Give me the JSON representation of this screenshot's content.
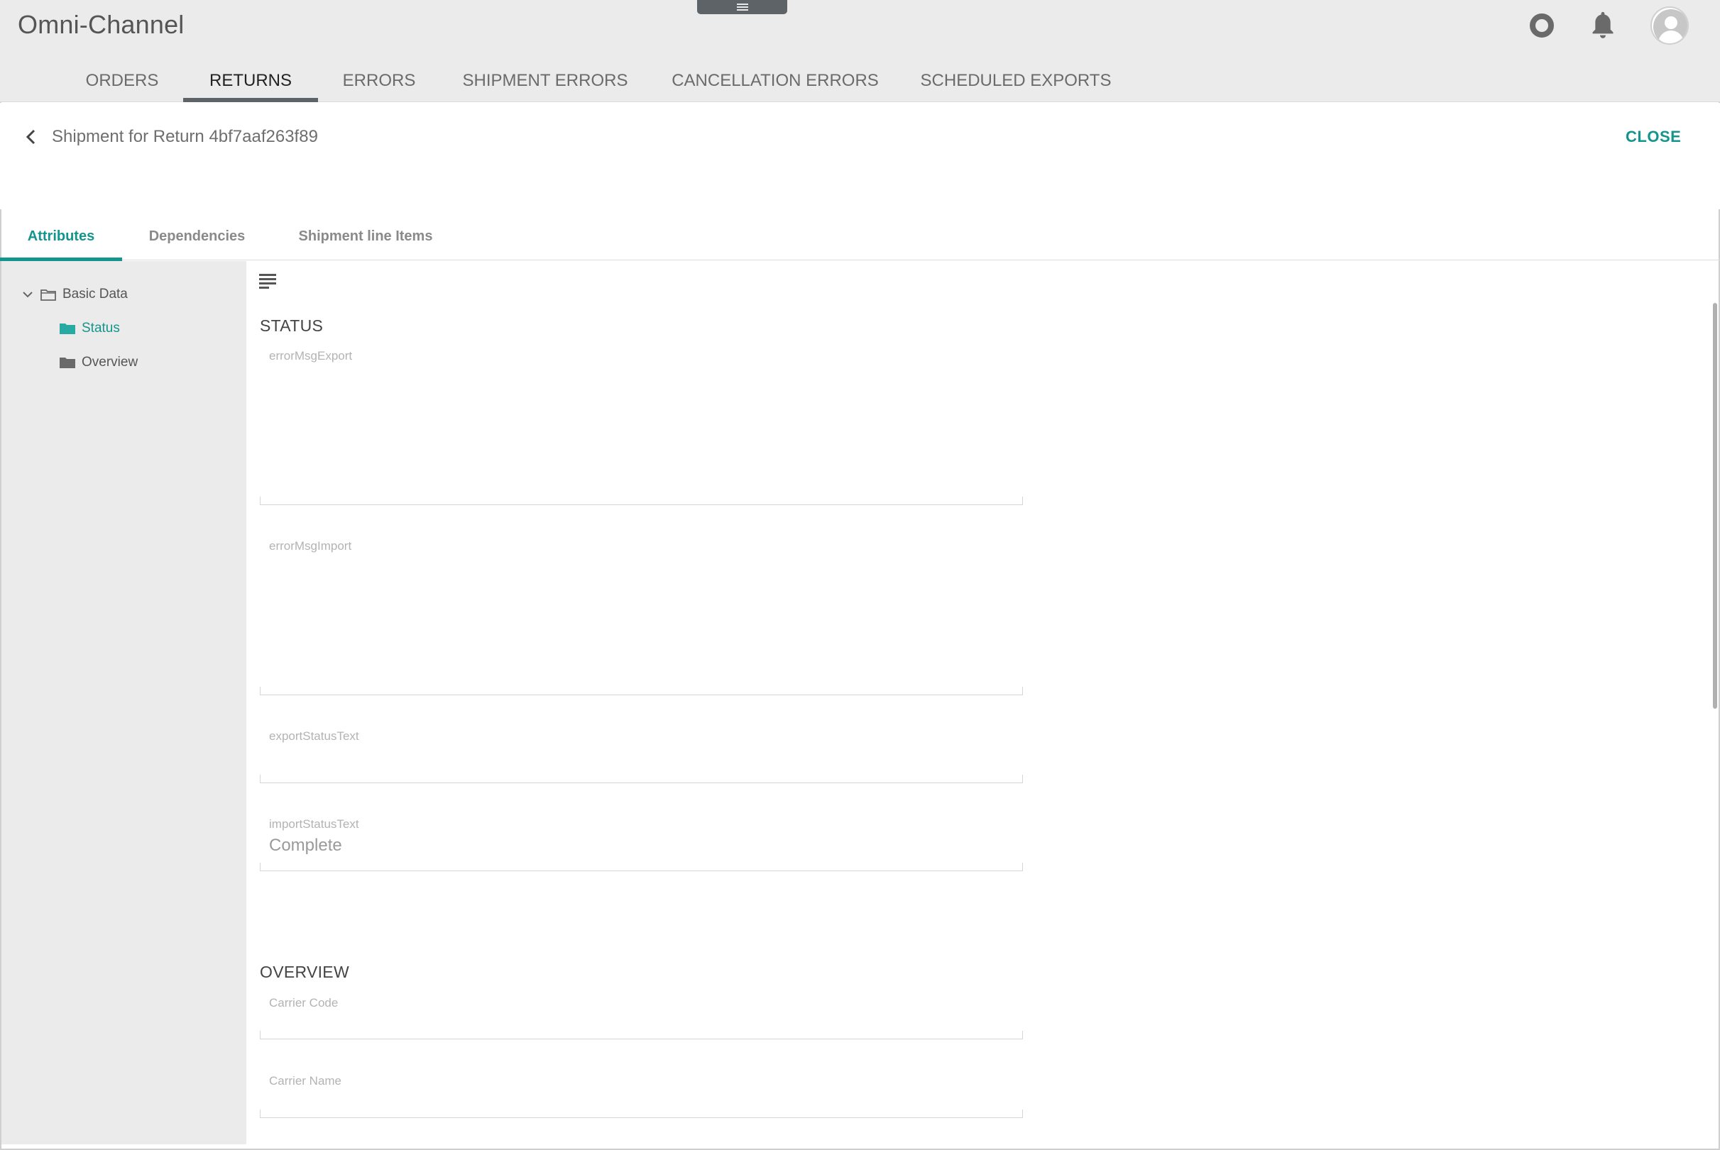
{
  "app": {
    "title": "Omni-Channel"
  },
  "nav": {
    "tabs": [
      {
        "label": "ORDERS",
        "active": false
      },
      {
        "label": "RETURNS",
        "active": true
      },
      {
        "label": "ERRORS",
        "active": false
      },
      {
        "label": "SHIPMENT ERRORS",
        "active": false
      },
      {
        "label": "CANCELLATION ERRORS",
        "active": false
      },
      {
        "label": "SCHEDULED EXPORTS",
        "active": false
      }
    ]
  },
  "detail": {
    "title": "Shipment for Return 4bf7aaf263f89",
    "close_label": "CLOSE"
  },
  "subtabs": [
    {
      "label": "Attributes",
      "active": true
    },
    {
      "label": "Dependencies",
      "active": false
    },
    {
      "label": "Shipment line Items",
      "active": false
    }
  ],
  "tree": {
    "root": {
      "label": "Basic Data",
      "icon": "folder-open-outline-icon"
    },
    "children": [
      {
        "label": "Status",
        "icon": "folder-icon",
        "selected": true
      },
      {
        "label": "Overview",
        "icon": "folder-icon",
        "selected": false
      }
    ]
  },
  "sections": {
    "status": {
      "title": "STATUS",
      "fields": [
        {
          "label": "errorMsgExport",
          "value": ""
        },
        {
          "label": "errorMsgImport",
          "value": ""
        },
        {
          "label": "exportStatusText",
          "value": ""
        },
        {
          "label": "importStatusText",
          "value": "Complete"
        }
      ]
    },
    "overview": {
      "title": "OVERVIEW",
      "fields": [
        {
          "label": "Carrier Code",
          "value": ""
        },
        {
          "label": "Carrier Name",
          "value": ""
        }
      ]
    }
  },
  "colors": {
    "accent": "#13958d",
    "header_bg": "#ebebeb",
    "nav_indicator": "#5d6366"
  }
}
